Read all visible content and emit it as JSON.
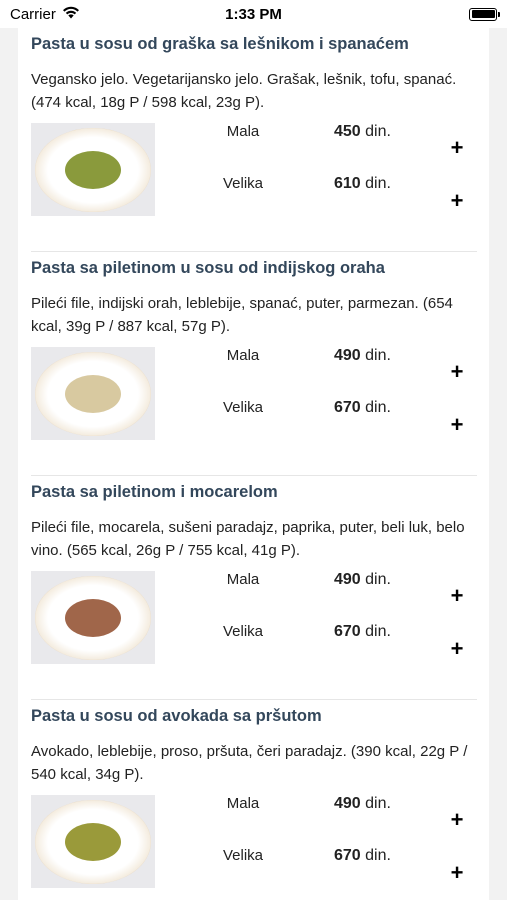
{
  "status": {
    "carrier": "Carrier",
    "time": "1:33 PM"
  },
  "currency": "din.",
  "items": [
    {
      "title": "Pasta u sosu od graška sa lešnikom i spanaćem",
      "description": "Vegansko jelo. Vegetarijansko jelo. Grašak, lešnik, tofu, spanać. (474 kcal, 18g P / 598 kcal, 23g P).",
      "sizes": [
        {
          "label": "Mala",
          "price": "450"
        },
        {
          "label": "Velika",
          "price": "610"
        }
      ],
      "food_color": "#8a9a3c"
    },
    {
      "title": "Pasta sa piletinom u sosu od indijskog oraha",
      "description": "Pileći file, indijski orah, leblebije, spanać, puter, parmezan. (654 kcal, 39g P / 887 kcal, 57g P).",
      "sizes": [
        {
          "label": "Mala",
          "price": "490"
        },
        {
          "label": "Velika",
          "price": "670"
        }
      ],
      "food_color": "#d8c9a0"
    },
    {
      "title": "Pasta sa piletinom i mocarelom",
      "description": "Pileći file, mocarela, sušeni paradajz, paprika, puter, beli luk, belo vino. (565 kcal, 26g P / 755 kcal, 41g P).",
      "sizes": [
        {
          "label": "Mala",
          "price": "490"
        },
        {
          "label": "Velika",
          "price": "670"
        }
      ],
      "food_color": "#a0664a"
    },
    {
      "title": "Pasta u sosu od avokada sa pršutom",
      "description": "Avokado, leblebije, proso, pršuta, čeri paradajz. (390 kcal, 22g P / 540 kcal, 34g P).",
      "sizes": [
        {
          "label": "Mala",
          "price": "490"
        },
        {
          "label": "Velika",
          "price": "670"
        }
      ],
      "food_color": "#9a9a3a"
    }
  ],
  "add_symbol": "+",
  "colors": {
    "title": "#33475b",
    "background": "#f2f2f2",
    "card": "#ffffff"
  }
}
